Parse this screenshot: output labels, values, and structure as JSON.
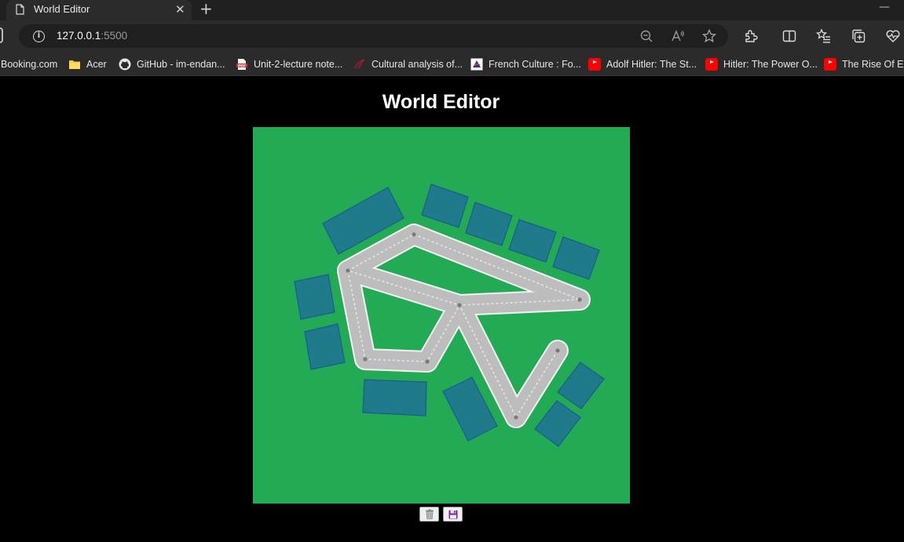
{
  "browser": {
    "tab_title": "World Editor",
    "tab_close": "✕",
    "new_tab": "+",
    "minimize": "—",
    "url_host": "127.0.0.1",
    "url_port": ":5500"
  },
  "bookmarks": [
    {
      "label": "Booking.com",
      "icon": "none"
    },
    {
      "label": "Acer",
      "icon": "folder-icon"
    },
    {
      "label": "GitHub - im-endan...",
      "icon": "github-icon"
    },
    {
      "label": "Unit-2-lecture note...",
      "icon": "pdf-icon"
    },
    {
      "label": "Cultural analysis of...",
      "icon": "swoosh-icon"
    },
    {
      "label": "French Culture : Fo...",
      "icon": "site-icon"
    },
    {
      "label": "Adolf Hitler: The St...",
      "icon": "youtube-icon"
    },
    {
      "label": "Hitler: The Power O...",
      "icon": "youtube-icon"
    },
    {
      "label": "The Rise Of Em",
      "icon": "youtube-icon"
    }
  ],
  "page": {
    "title": "World Editor"
  },
  "world": {
    "colors": {
      "ground": "#22aa55",
      "road": "#bbbbbb",
      "road_border": "#ffffff",
      "lane_marking": "#e0e0e0",
      "building": "#1f7a8c",
      "building_border": "#1a5d8a",
      "point": "#7a7a7a"
    }
  },
  "controls": {
    "dispose_icon": "trash-icon",
    "save_icon": "floppy-disk-icon"
  }
}
